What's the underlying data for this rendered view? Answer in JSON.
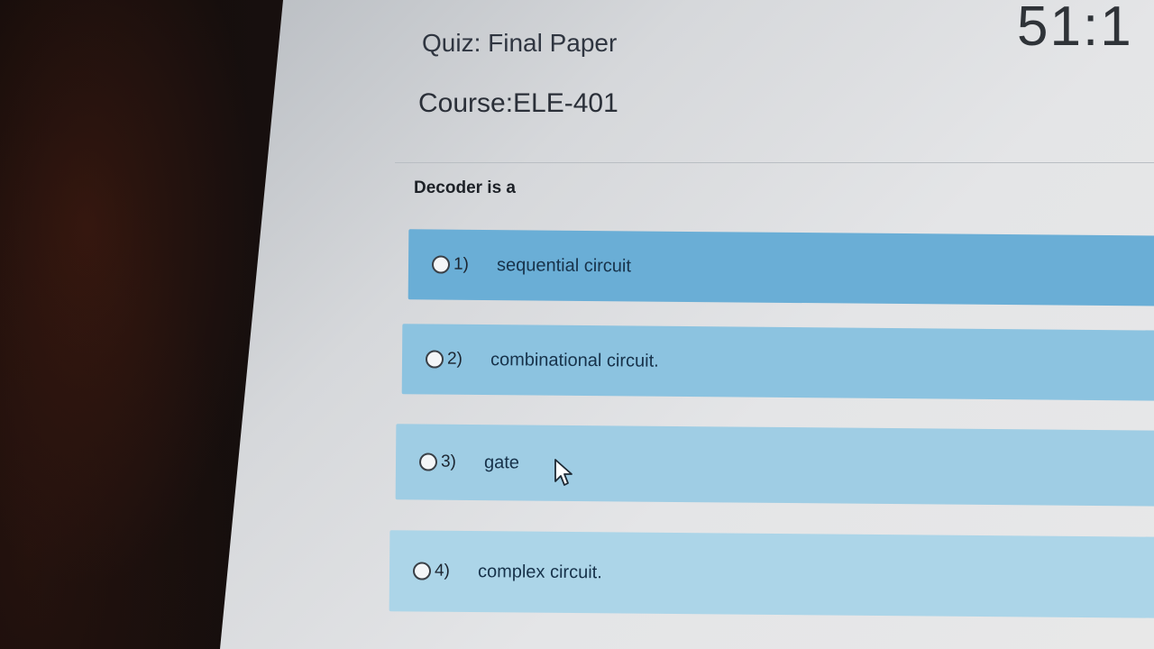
{
  "timer": "51:1",
  "header": {
    "quiz_title": "Quiz: Final Paper",
    "course_title": "Course:ELE-401"
  },
  "question": {
    "text": "Decoder is a",
    "options": [
      {
        "number": "1)",
        "label": "sequential circuit"
      },
      {
        "number": "2)",
        "label": "combinational circuit."
      },
      {
        "number": "3)",
        "label": "gate"
      },
      {
        "number": "4)",
        "label": "complex circuit."
      }
    ]
  },
  "icons": {
    "cursor": "mouse-pointer-icon",
    "radio": "radio-button"
  },
  "colors": {
    "option_1_bg": "#6aaed6",
    "option_2_bg": "#8cc3e0",
    "option_3_bg": "#9fcde4",
    "option_4_bg": "#acd5e8"
  }
}
